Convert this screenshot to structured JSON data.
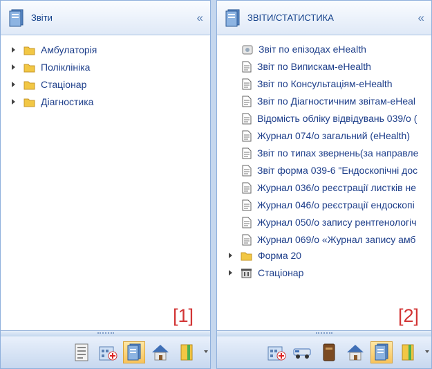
{
  "left_panel": {
    "title": "Звіти",
    "collapse_glyph": "«",
    "items": [
      {
        "label": "Амбулаторія",
        "icon": "folder-icon"
      },
      {
        "label": "Поліклініка",
        "icon": "folder-icon"
      },
      {
        "label": "Стаціонар",
        "icon": "folder-icon"
      },
      {
        "label": "Діагностика",
        "icon": "folder-icon"
      }
    ],
    "marker": "[1]",
    "toolbar_icons": [
      "report-list-icon",
      "hospital-icon",
      "reports-book-icon",
      "home-icon",
      "folder-book-icon"
    ]
  },
  "right_panel": {
    "title": "ЗВІТИ/СТАТИСТИКА",
    "collapse_glyph": "«",
    "items": [
      {
        "label": "Звіт по епізодах eHealth",
        "icon": "report-special-icon"
      },
      {
        "label": "Звіт по Випискам-eHealth",
        "icon": "document-icon"
      },
      {
        "label": "Звіт по Консультаціям-eHealth",
        "icon": "document-icon"
      },
      {
        "label": "Звіт по Діагностичним звітам-eHeal",
        "icon": "document-icon"
      },
      {
        "label": "Відомість обліку відвідувань 039/о (",
        "icon": "document-icon"
      },
      {
        "label": "Журнал 074/о загальний (eHealth)",
        "icon": "document-icon"
      },
      {
        "label": "Звіт по типах звернень(за направле",
        "icon": "document-icon"
      },
      {
        "label": "Звіт форма 039-6 \"Ендоскопічні дос",
        "icon": "document-icon"
      },
      {
        "label": "Журнал 036/о реєстрації листків не",
        "icon": "document-icon"
      },
      {
        "label": "Журнал 046/о реєстрації ендоскопі",
        "icon": "document-icon"
      },
      {
        "label": "Журнал 050/о запису рентгенологіч",
        "icon": "document-icon"
      },
      {
        "label": "Журнал 069/о «Журнал запису амб",
        "icon": "document-icon"
      },
      {
        "label": "Форма 20",
        "icon": "folder-icon"
      },
      {
        "label": "Стаціонар",
        "icon": "building-icon"
      }
    ],
    "marker": "[2]",
    "toolbar_icons": [
      "hospital-icon",
      "ambulance-icon",
      "book-icon",
      "home-icon",
      "reports-book-icon",
      "folder-book-icon"
    ]
  },
  "colors": {
    "item_text": "#1d3e8a",
    "header_text": "#15428b",
    "marker": "#d23535",
    "active_tool": "#f8c35a"
  }
}
